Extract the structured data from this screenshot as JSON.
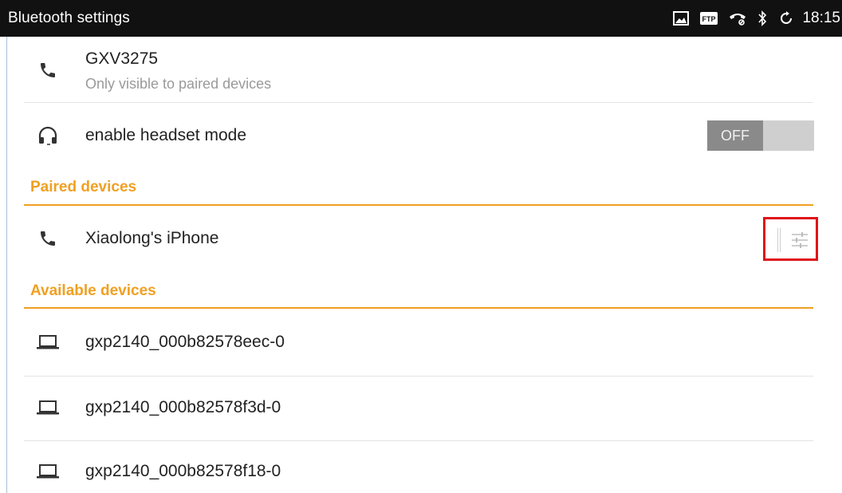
{
  "status_bar": {
    "title": "Bluetooth settings",
    "time": "18:15",
    "icons": [
      "image-icon",
      "ftp-icon",
      "voicemail-icon",
      "bluetooth-icon",
      "sync-icon"
    ],
    "ftp_text": "FTP"
  },
  "device": {
    "name": "GXV3275",
    "visibility": "Only visible to paired devices",
    "icon": "phone-icon"
  },
  "headset": {
    "label": "enable headset mode",
    "icon": "headset-icon",
    "toggle_state": "OFF"
  },
  "paired": {
    "header": "Paired devices",
    "items": [
      {
        "name": "Xiaolong's iPhone",
        "icon": "phone-icon",
        "action_icon": "settings-sliders-icon"
      }
    ]
  },
  "available": {
    "header": "Available devices",
    "items": [
      {
        "name": "gxp2140_000b82578eec-0",
        "icon": "laptop-icon"
      },
      {
        "name": "gxp2140_000b82578f3d-0",
        "icon": "laptop-icon"
      },
      {
        "name": "gxp2140_000b82578f18-0",
        "icon": "laptop-icon"
      }
    ]
  },
  "colors": {
    "section_accent": "#f0a022",
    "highlight_box": "#e0121a",
    "status_bar_bg": "#111111"
  }
}
